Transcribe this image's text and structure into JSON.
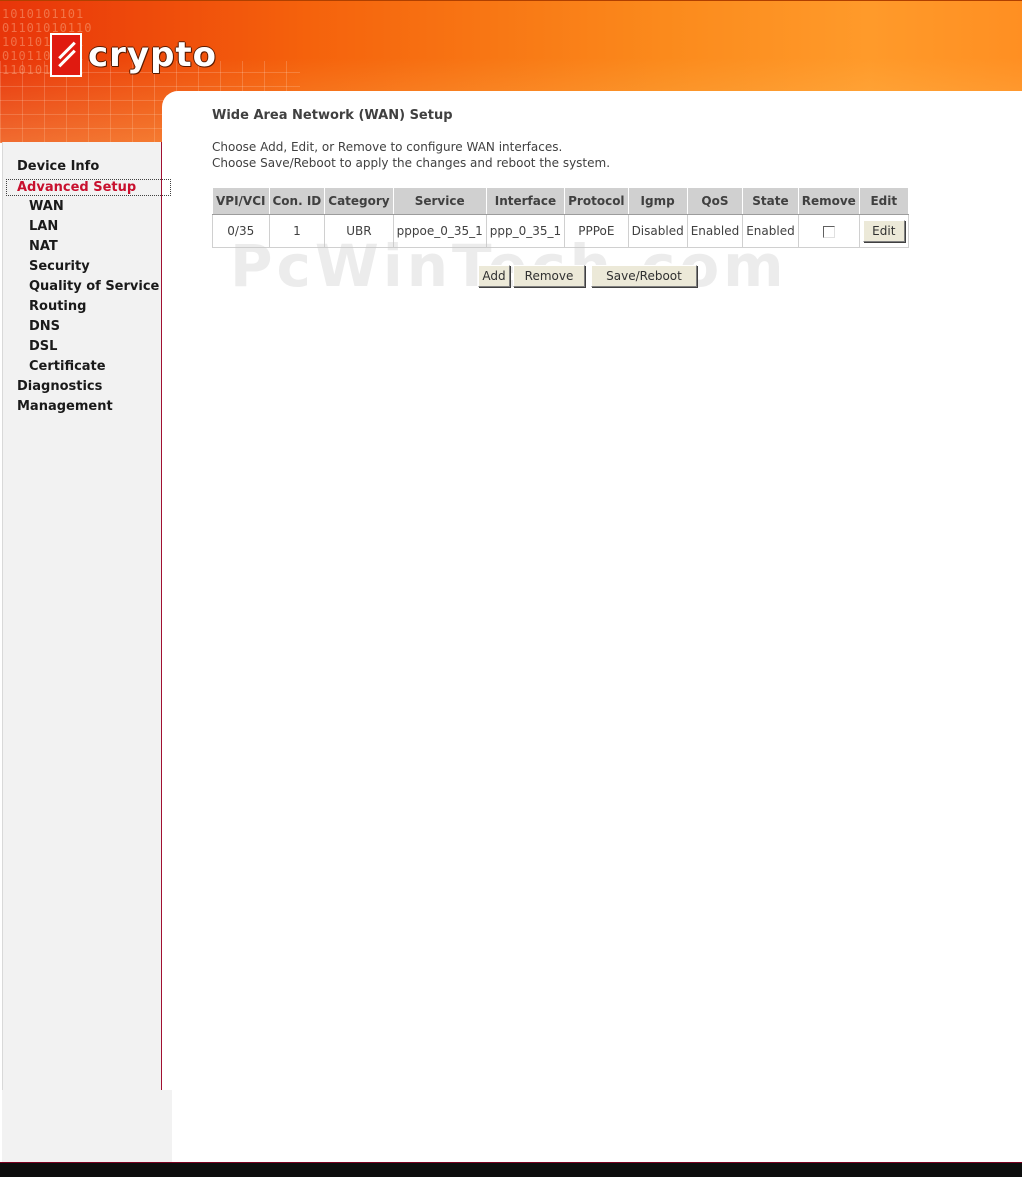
{
  "brand": {
    "logo_text": "crypto"
  },
  "sidebar": {
    "items": [
      {
        "label": "Device Info"
      },
      {
        "label": "Advanced Setup"
      },
      {
        "label": "WAN"
      },
      {
        "label": "LAN"
      },
      {
        "label": "NAT"
      },
      {
        "label": "Security"
      },
      {
        "label": "Quality of Service"
      },
      {
        "label": "Routing"
      },
      {
        "label": "DNS"
      },
      {
        "label": "DSL"
      },
      {
        "label": "Certificate"
      },
      {
        "label": "Diagnostics"
      },
      {
        "label": "Management"
      }
    ],
    "active_item": "Advanced Setup"
  },
  "main": {
    "title": "Wide Area Network (WAN) Setup",
    "instructions": [
      "Choose Add, Edit, or Remove to configure WAN interfaces.",
      "Choose Save/Reboot to apply the changes and reboot the system."
    ],
    "table": {
      "headers": [
        "VPI/VCI",
        "Con. ID",
        "Category",
        "Service",
        "Interface",
        "Protocol",
        "Igmp",
        "QoS",
        "State",
        "Remove",
        "Edit"
      ],
      "rows": [
        {
          "vpi_vci": "0/35",
          "con_id": "1",
          "category": "UBR",
          "service": "pppoe_0_35_1",
          "interface": "ppp_0_35_1",
          "protocol": "PPPoE",
          "igmp": "Disabled",
          "qos": "Enabled",
          "state": "Enabled",
          "remove_checked": false,
          "edit_label": "Edit"
        }
      ]
    },
    "buttons": {
      "add": "Add",
      "remove": "Remove",
      "save_reboot": "Save/Reboot"
    },
    "watermark": "PcWinTech.com"
  },
  "colors": {
    "banner_start": "#e8350a",
    "banner_end": "#ff9a2a",
    "active_nav": "#c8102e",
    "table_header": "#d0d0d0",
    "sidebar_bg": "#f2f2f2"
  }
}
